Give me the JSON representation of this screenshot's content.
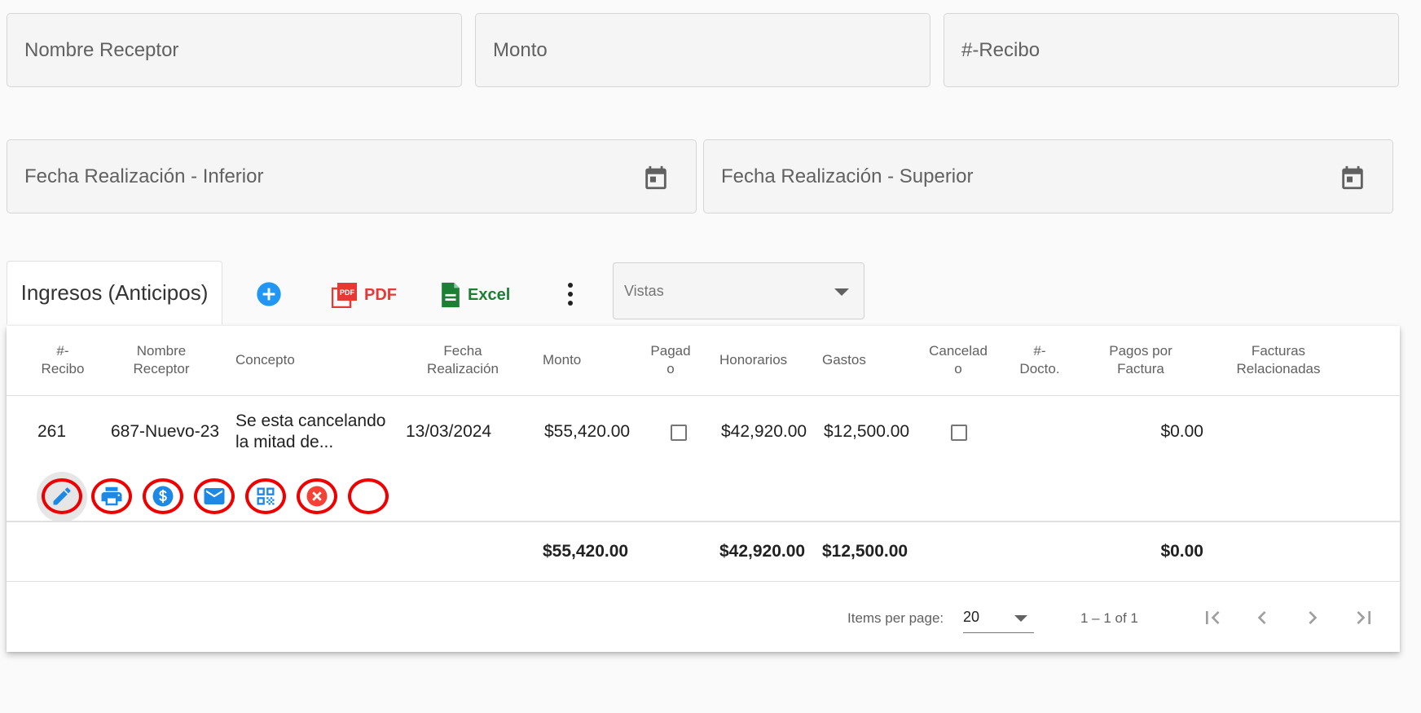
{
  "filters": {
    "nombre_receptor": "Nombre Receptor",
    "monto": "Monto",
    "recibo": "#-Recibo",
    "fecha_inferior": "Fecha Realización - Inferior",
    "fecha_superior": "Fecha Realización - Superior"
  },
  "toolbar": {
    "tab_label": "Ingresos (Anticipos)",
    "pdf_label": "PDF",
    "pdf_badge": "PDF",
    "excel_label": "Excel",
    "vistas_label": "Vistas"
  },
  "table": {
    "headers": {
      "recibo": [
        "#-",
        "Recibo"
      ],
      "nombre_receptor": [
        "Nombre",
        "Receptor"
      ],
      "concepto": "Concepto",
      "fecha": [
        "Fecha",
        "Realización"
      ],
      "monto": "Monto",
      "pagado": [
        "Pagad",
        "o"
      ],
      "honorarios": "Honorarios",
      "gastos": "Gastos",
      "cancelado": [
        "Cancelad",
        "o"
      ],
      "docto": [
        "#-",
        "Docto."
      ],
      "pagos_factura": [
        "Pagos por",
        "Factura"
      ],
      "facturas_rel": [
        "Facturas",
        "Relacionadas"
      ]
    },
    "rows": [
      {
        "recibo": "261",
        "nombre_receptor": "687-Nuevo-23",
        "concepto": [
          "Se esta cancelando",
          "la mitad de..."
        ],
        "fecha": "13/03/2024",
        "monto": "$55,420.00",
        "honorarios": "$42,920.00",
        "gastos": "$12,500.00",
        "pagos_factura": "$0.00"
      }
    ],
    "totals": {
      "monto": "$55,420.00",
      "honorarios": "$42,920.00",
      "gastos": "$12,500.00",
      "pagos_factura": "$0.00"
    }
  },
  "actions": [
    "edit-icon",
    "print-icon",
    "dollar-icon",
    "email-icon",
    "qr-code-icon",
    "cancel-icon",
    "empty"
  ],
  "paginator": {
    "items_per_page_label": "Items per page:",
    "items_per_page": "20",
    "range": "1 – 1 of 1"
  },
  "colors": {
    "accent_blue": "#2196f3",
    "pdf_red": "#e53935",
    "excel_green": "#1e7e34",
    "cancel_red": "#f44336",
    "highlight_ring": "#ee0000"
  }
}
